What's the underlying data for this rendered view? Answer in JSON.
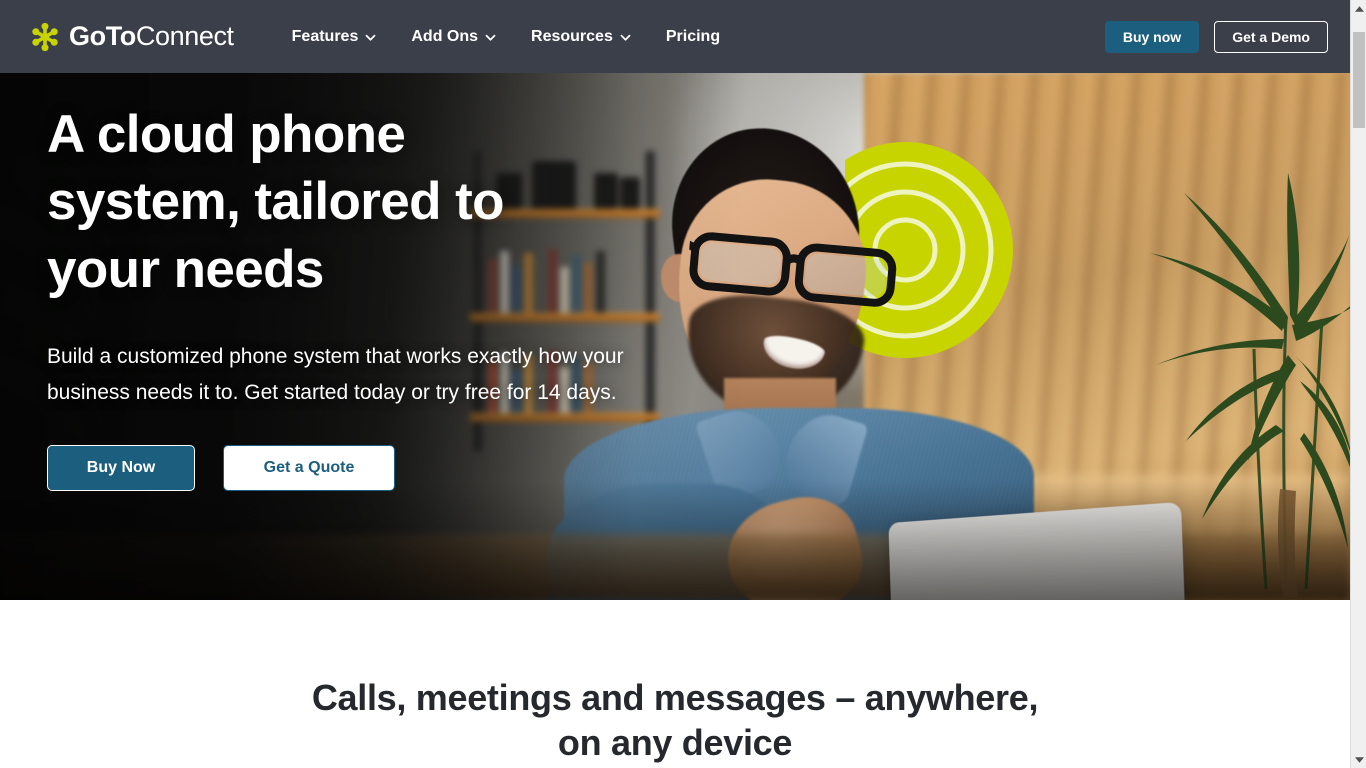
{
  "browser": {
    "scrollbar": {
      "up_arrow_icon": "chevron-up-icon",
      "down_arrow_icon": "chevron-down-icon"
    }
  },
  "header": {
    "brand": {
      "logo_icon": "goto-asterisk-icon",
      "name_bold": "GoTo",
      "name_light": "Connect",
      "logo_color": "#c8d400"
    },
    "nav": [
      {
        "label": "Features",
        "has_dropdown": true,
        "icon": "chevron-down-icon"
      },
      {
        "label": "Add Ons",
        "has_dropdown": true,
        "icon": "chevron-down-icon"
      },
      {
        "label": "Resources",
        "has_dropdown": true,
        "icon": "chevron-down-icon"
      },
      {
        "label": "Pricing",
        "has_dropdown": false,
        "icon": ""
      }
    ],
    "actions": {
      "buy_now": "Buy now",
      "get_demo": "Get a Demo"
    },
    "background_color": "#3b3f4a",
    "accent_color": "#1c5e7e"
  },
  "hero": {
    "title": "A cloud phone\nsystem, tailored to\nyour needs",
    "subtitle": "Build a customized phone system that works exactly how your business needs it to. Get started today or try free for 14 days.",
    "cta_primary": "Buy Now",
    "cta_secondary": "Get a Quote",
    "image_description": "Smiling man with glasses in denim shirt using a laptop at a wooden desk",
    "primary_color": "#1c5e7e"
  },
  "section_calls": {
    "heading": "Calls, meetings and messages – anywhere,\non any device",
    "text_color": "#25282d"
  }
}
